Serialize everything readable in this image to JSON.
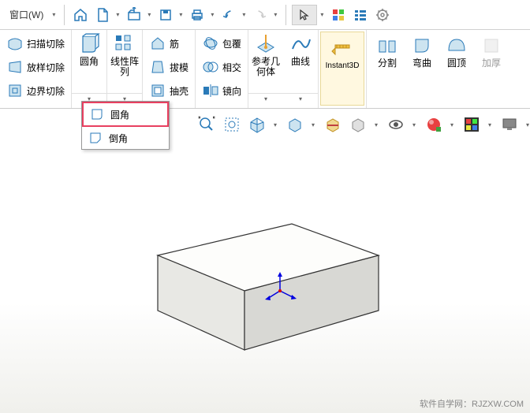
{
  "menu": {
    "window": "窗口(W)"
  },
  "ribbon": {
    "scan_cut": "扫描切除",
    "loft_cut": "放样切除",
    "boundary_cut": "边界切除",
    "fillet": "圆角",
    "linear_pattern": "线性阵\n列",
    "rib": "筋",
    "draft": "拔模",
    "shell": "抽壳",
    "wrap": "包覆",
    "intersect": "相交",
    "mirror": "镜向",
    "ref_geom": "参考几\n何体",
    "curves": "曲线",
    "instant3d": "Instant3D",
    "split": "分割",
    "bend": "弯曲",
    "dome": "圆顶",
    "thicken": "加厚"
  },
  "popup": {
    "fillet": "圆角",
    "chamfer": "倒角"
  },
  "watermark": "软件自学网：RJZXW.COM"
}
